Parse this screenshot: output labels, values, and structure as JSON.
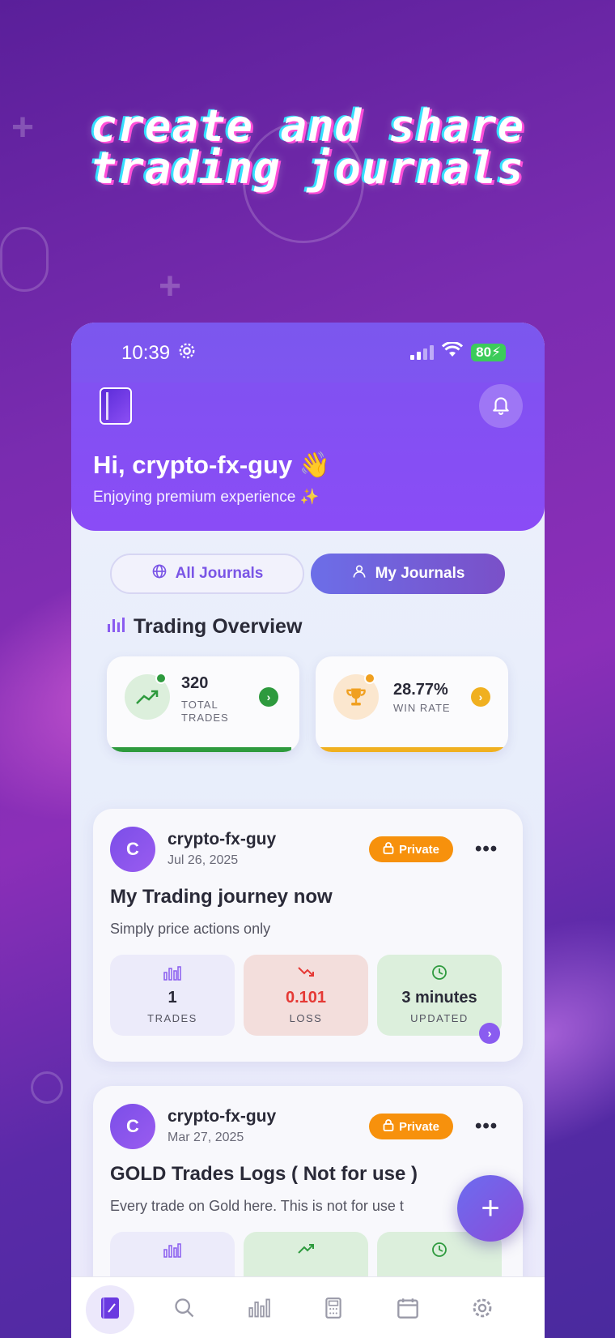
{
  "hero": {
    "title_line1": "create and share",
    "title_line2": "trading journals"
  },
  "status_bar": {
    "time": "10:39",
    "battery": "80"
  },
  "header": {
    "greeting": "Hi, crypto-fx-guy 👋",
    "subtitle": "Enjoying premium experience ✨"
  },
  "tabs": {
    "all_label": "All Journals",
    "my_label": "My Journals",
    "selected": "My Journals"
  },
  "overview": {
    "title": "Trading Overview",
    "total_trades": {
      "value": "320",
      "label_line1": "TOTAL",
      "label_line2": "TRADES"
    },
    "win_rate": {
      "value": "28.77%",
      "label": "WIN RATE"
    }
  },
  "journals": [
    {
      "avatar_letter": "C",
      "author": "crypto-fx-guy",
      "date": "Jul 26, 2025",
      "badge": "Private",
      "title": "My Trading journey now",
      "description": "Simply price actions only",
      "metrics": [
        {
          "value": "1",
          "label": "TRADES"
        },
        {
          "value": "0.101",
          "label": "LOSS"
        },
        {
          "value": "3 minutes",
          "label": "UPDATED"
        }
      ]
    },
    {
      "avatar_letter": "C",
      "author": "crypto-fx-guy",
      "date": "Mar 27, 2025",
      "badge": "Private",
      "title": "GOLD Trades Logs ( Not for use )",
      "description": "Every trade on Gold here. This is not for use t"
    }
  ],
  "colors": {
    "header_purple": "#8a4cf6",
    "private_orange": "#f7910c",
    "loss_red": "#e53935",
    "trades_green": "#2e9a3e",
    "winrate_gold": "#f0b020"
  },
  "bottom_nav": [
    "journal-icon",
    "search-icon",
    "chart-icon",
    "calculator-icon",
    "calendar-icon",
    "gear-icon"
  ]
}
